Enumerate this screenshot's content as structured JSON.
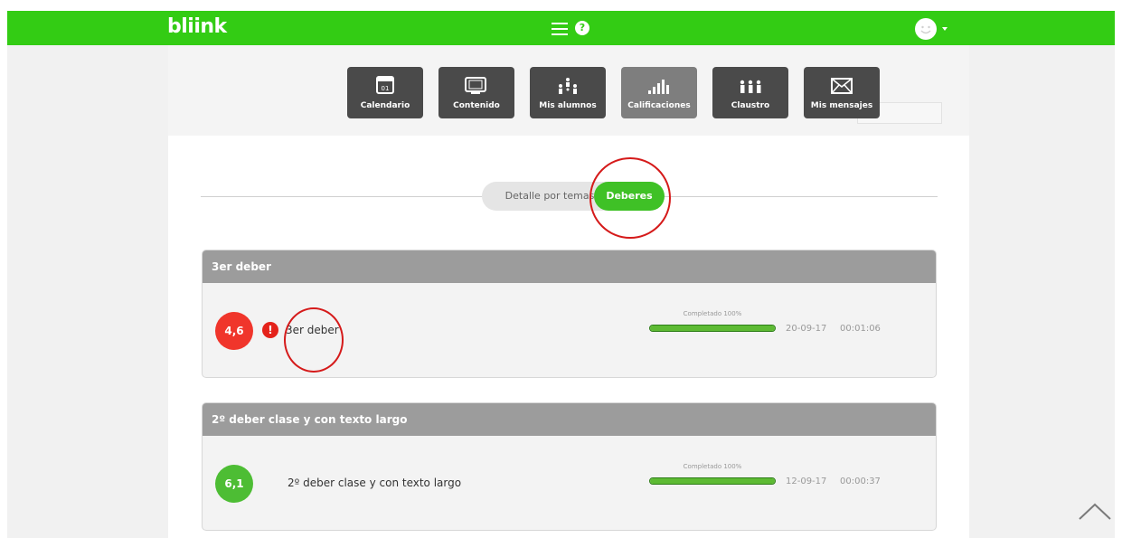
{
  "app": {
    "logo": "bliink"
  },
  "header": {
    "help_icon": "?",
    "avatar_icon": "smiley-avatar"
  },
  "nav": [
    {
      "label": "Calendario",
      "icon": "calendar-icon",
      "day": "01"
    },
    {
      "label": "Contenido",
      "icon": "monitor-icon"
    },
    {
      "label": "Mis alumnos",
      "icon": "students-icon"
    },
    {
      "label": "Calificaciones",
      "icon": "bar-chart-icon",
      "active": true
    },
    {
      "label": "Claustro",
      "icon": "staff-icon"
    },
    {
      "label": "Mis mensajes",
      "icon": "envelope-icon"
    }
  ],
  "tabs": {
    "detalle": "Detalle por temas",
    "deberes": "Deberes"
  },
  "tasks": [
    {
      "header": "3er deber",
      "score": "4,6",
      "score_color": "#f0352b",
      "alert": "!",
      "title": "3er deber",
      "progress_label": "Completado 100%",
      "progress": 1.0,
      "date": "20-09-17",
      "time": "00:01:06"
    },
    {
      "header": "2º deber clase y con texto largo",
      "score": "6,1",
      "score_color": "#4dbd34",
      "title": "2º deber clase y con texto largo",
      "progress_label": "Completado 100%",
      "progress": 1.0,
      "date": "12-09-17",
      "time": "00:00:37"
    }
  ],
  "colors": {
    "brand": "#33cc14",
    "nav_button": "#4a4a4a",
    "nav_active": "#7e7e7e",
    "annotation": "#d51a1a"
  }
}
